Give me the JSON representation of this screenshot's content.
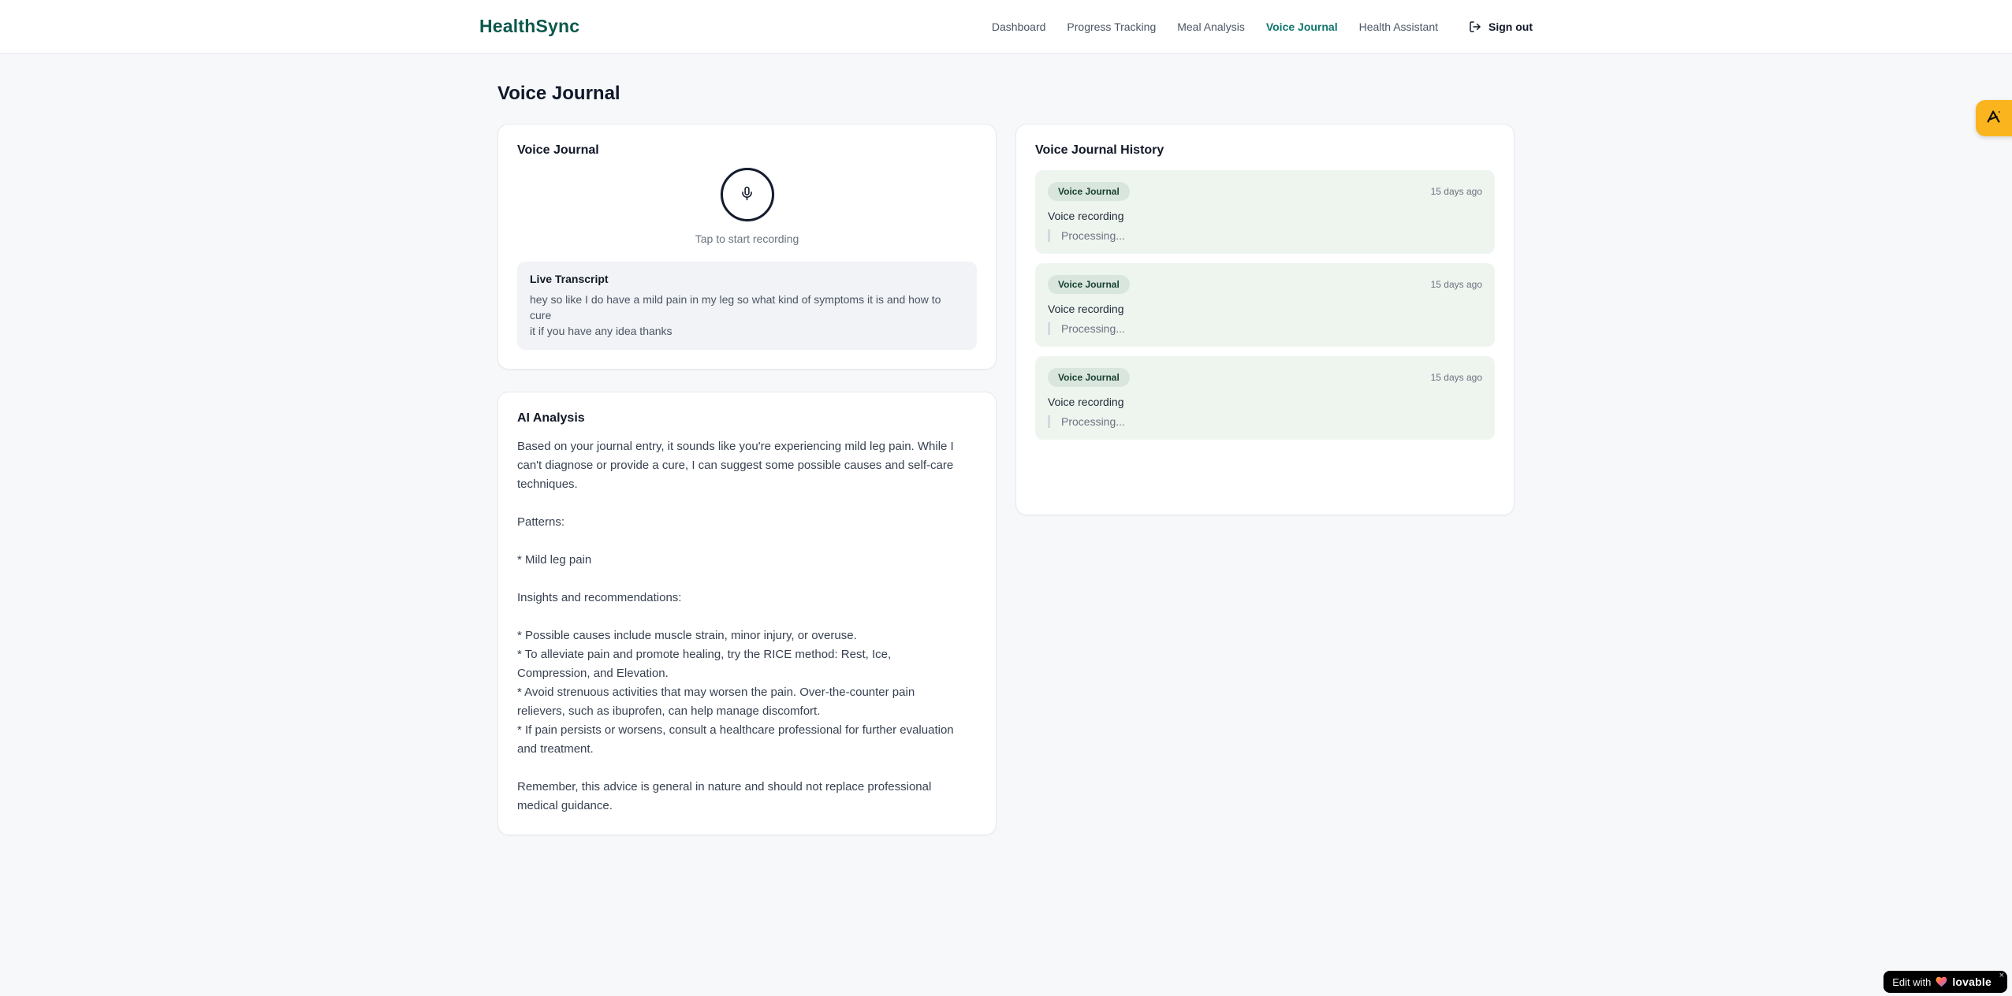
{
  "colors": {
    "brand_green": "#0c584c",
    "nav_active_green": "#0f766e",
    "history_item_bg": "#eef5ef",
    "badge_bg": "#d9e6dd",
    "badge_text": "#173f32",
    "side_tab_orange": "#f9b41e",
    "lovable_badge_bg": "#000000"
  },
  "brand": {
    "name": "HealthSync"
  },
  "nav": {
    "items": [
      {
        "label": "Dashboard"
      },
      {
        "label": "Progress Tracking"
      },
      {
        "label": "Meal Analysis"
      },
      {
        "label": "Voice Journal"
      },
      {
        "label": "Health Assistant"
      }
    ],
    "active": "Voice Journal",
    "sign_out_label": "Sign out"
  },
  "page": {
    "title": "Voice Journal"
  },
  "recorder": {
    "title": "Voice Journal",
    "mic_icon": "microphone",
    "tap_hint": "Tap to start recording",
    "transcript_title": "Live Transcript",
    "transcript_text": "hey so like I do have a mild pain in my leg so what kind of symptoms it is and how to cure\nit if you have any idea thanks"
  },
  "analysis": {
    "title": "AI Analysis",
    "body": "Based on your journal entry, it sounds like you're experiencing mild leg pain. While I\ncan't diagnose or provide a cure, I can suggest some possible causes and self-care\ntechniques.\n\nPatterns:\n\n* Mild leg pain\n\nInsights and recommendations:\n\n* Possible causes include muscle strain, minor injury, or overuse.\n* To alleviate pain and promote healing, try the RICE method: Rest, Ice,\nCompression, and Elevation.\n* Avoid strenuous activities that may worsen the pain. Over-the-counter pain\nrelievers, such as ibuprofen, can help manage discomfort.\n* If pain persists or worsens, consult a healthcare professional for further evaluation\nand treatment.\n\nRemember, this advice is general in nature and should not replace professional\nmedical guidance."
  },
  "history": {
    "title": "Voice Journal History",
    "entries": [
      {
        "badge": "Voice Journal",
        "time": "15 days ago",
        "label": "Voice recording",
        "status": "Processing..."
      },
      {
        "badge": "Voice Journal",
        "time": "15 days ago",
        "label": "Voice recording",
        "status": "Processing..."
      },
      {
        "badge": "Voice Journal",
        "time": "15 days ago",
        "label": "Voice recording",
        "status": "Processing..."
      }
    ]
  },
  "widgets": {
    "side_tab_icon": "anima-logo",
    "edit_with": "Edit with",
    "lovable": "lovable",
    "close": "×"
  }
}
